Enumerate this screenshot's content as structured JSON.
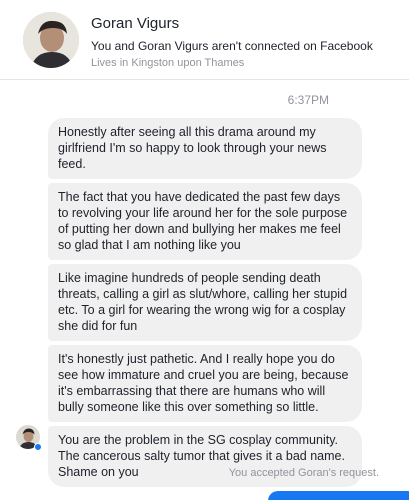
{
  "header": {
    "name": "Goran Vigurs",
    "connection_text": "You and Goran Vigurs aren't connected on Facebook",
    "location_text": "Lives in Kingston upon Thames"
  },
  "timestamp": "6:37PM",
  "messages": [
    "Honestly after seeing all this drama around my girlfriend I'm so happy to look through your news feed.",
    "The fact that you have dedicated the past few days to revolving your life around her for the sole purpose of putting her down and bullying her makes me feel so glad that I am nothing like you",
    "Like imagine hundreds of people sending death threats, calling a girl as slut/whore, calling her stupid etc. To a girl for wearing the wrong wig for a cosplay she did for fun",
    "It's honestly just pathetic. And I really hope you do see how immature and cruel you are being, because it's embarrassing that there are humans who will bully someone like this over something so little.",
    "You are the problem in the SG cosplay community. The cancerous salty tumor that gives it a bad name. Shame on you"
  ],
  "footer": {
    "accepted_text": "You accepted Goran's request."
  },
  "colors": {
    "bubble_bg": "#f1f0f0",
    "accent": "#1877f2",
    "muted_text": "#90949c"
  }
}
